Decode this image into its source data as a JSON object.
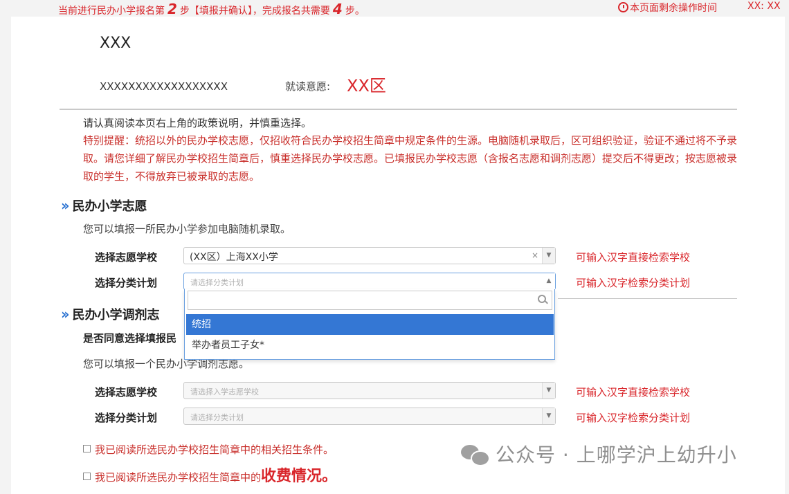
{
  "topbar": {
    "step_prefix": "当前进行民办小学报名第",
    "step_current": "2",
    "step_middle": "步【填报并确认】，完成报名共需要",
    "step_total": "4",
    "step_suffix": "步。",
    "time_label": "本页面剩余操作时间",
    "time_value": "XX: XX"
  },
  "applicant": {
    "name": "XXX",
    "id_number": "XXXXXXXXXXXXXXXXXX",
    "intent_label": "就读意愿:",
    "intent_value": "XX区"
  },
  "notice": "请认真阅读本页右上角的政策说明，并慎重选择。",
  "warning": "特别提醒：统招以外的民办学校志愿，仅招收符合民办学校招生简章中规定条件的生源。电脑随机录取后，区可组织验证，验证不通过将不予录取。请您详细了解民办学校招生简章后，慎重选择民办学校志愿。已填报民办学校志愿（含报名志愿和调剂志愿）提交后不得更改；按志愿被录取的学生，不得放弃已被录取的志愿。",
  "section1": {
    "title": "民办小学志愿",
    "subtitle": "您可以填报一所民办小学参加电脑随机录取。",
    "school_label": "选择志愿学校",
    "school_value": "(XX区）上海XX小学",
    "school_clear": "×",
    "plan_label": "选择分类计划",
    "plan_placeholder": "请选择分类计划",
    "dropdown_options": [
      "统招",
      "举办者员工子女*"
    ]
  },
  "section2": {
    "title": "民办小学调剂志",
    "question": "是否同意选择填报民",
    "subtitle": "您可以填报一个民办小学调剂志愿。",
    "school_label": "选择志愿学校",
    "school_placeholder": "请选择入学志愿学校",
    "plan_label": "选择分类计划",
    "plan_placeholder": "请选择分类计划"
  },
  "hints": {
    "school": "可输入汉字直接检索学校",
    "plan": "可输入汉字检索分类计划"
  },
  "checkboxes": {
    "item1": "我已阅读所选民办学校招生简章中的相关招生条件。",
    "item2_prefix": "我已阅读所选民办学校招生简章中的",
    "item2_emphasis": "收费情况。"
  },
  "watermark": "公众号 · 上哪学沪上幼升小",
  "colors": {
    "accent_red": "#d9262b",
    "selected_blue": "#3477d4",
    "chevron_blue": "#2b73d2"
  },
  "icons": {
    "clock": "clock-icon",
    "chevron": "double-chevron-right-icon",
    "search": "search-icon",
    "dropdown_arrow": "chevron-down-icon",
    "wechat": "wechat-icon"
  }
}
